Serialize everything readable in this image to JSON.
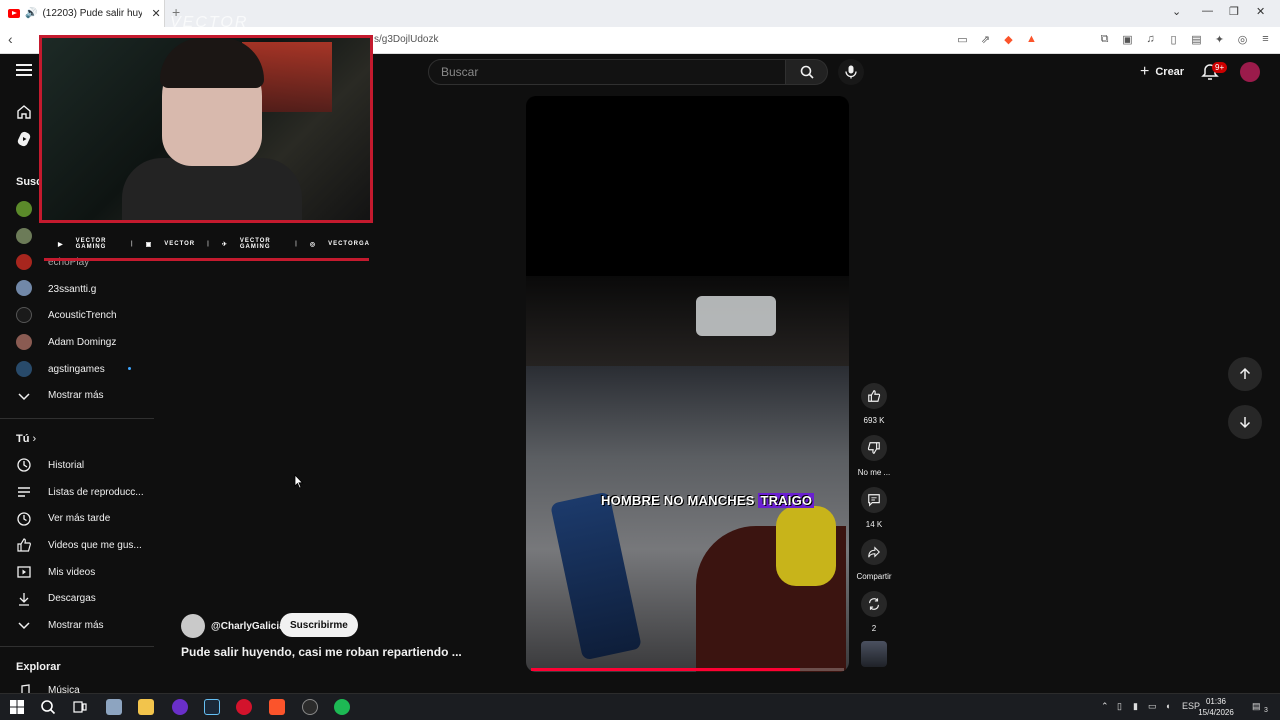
{
  "browser": {
    "tab_title": "(12203) Pude salir huyendo, c",
    "url": "s/g3DojlUdozk"
  },
  "header": {
    "search_placeholder": "Buscar",
    "create_label": "Crear",
    "notif_badge": "9+"
  },
  "sidebar": {
    "subs_heading": "Susc",
    "channels": [
      "echoPlay",
      "23ssantti.g",
      "AcousticTrench",
      "Adam Domingz",
      "agstingames"
    ],
    "show_more_1": "Mostrar más",
    "you_heading": "Tú",
    "you_items": [
      "Historial",
      "Listas de reproducc...",
      "Ver más tarde",
      "Videos que me gus...",
      "Mis videos",
      "Descargas"
    ],
    "show_more_2": "Mostrar más",
    "explore_heading": "Explorar",
    "explore_items": [
      "Música"
    ]
  },
  "overlay": {
    "watermark": "VECTOR",
    "socials": [
      {
        "icon": "youtube-icon",
        "label": "VECTOR GAMING"
      },
      {
        "icon": "twitch-icon",
        "label": "VECTOR"
      },
      {
        "icon": "twitter-icon",
        "label": "VECTOR GAMING"
      },
      {
        "icon": "instagram-icon",
        "label": "VECTORGA"
      }
    ]
  },
  "short": {
    "caption_main": "HOMBRE NO MANCHES ",
    "caption_highlight": "TRAIGO",
    "channel": "@CharlyGalicia",
    "subscribe_label": "Suscribirme",
    "title": "Pude salir huyendo, casi me roban repartiendo ...",
    "progress_fraction": 0.86,
    "likes": "693 K",
    "dislike_label": "No me ...",
    "comments": "14 K",
    "share_label": "Compartir",
    "remix_count": "2"
  },
  "taskbar": {
    "lang": "ESP",
    "time": "01:36",
    "date": "15/4/2026",
    "notif_count": "3"
  },
  "colors": {
    "background": "#0f0f0f",
    "accent_red": "#ff0033",
    "overlay_red": "#c41a2e",
    "caption_highlight": "#6a1fd1"
  }
}
